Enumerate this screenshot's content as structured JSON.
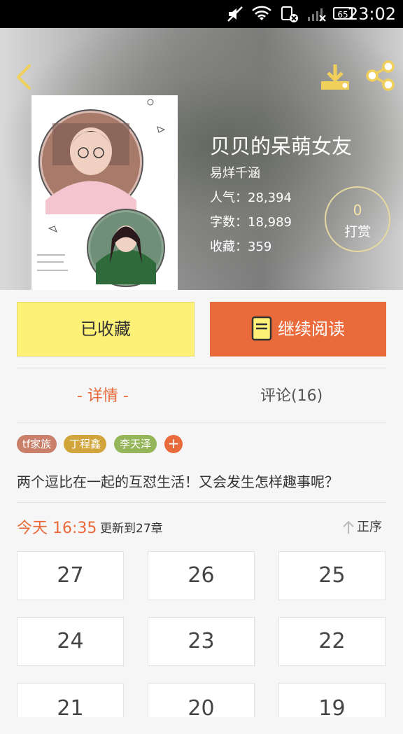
{
  "status_bar": {
    "time": "23:02",
    "battery": "65"
  },
  "book": {
    "title": "贝贝的呆萌女友",
    "author": "易烊千涵",
    "popularity": "人气：28,394",
    "word_count": "字数：18,989",
    "favorites": "收藏：359"
  },
  "reward": {
    "count": "0",
    "label": "打赏"
  },
  "actions": {
    "favorited_label": "已收藏",
    "continue_label": "继续阅读"
  },
  "tabs": {
    "detail": "- 详情 -",
    "comments": "评论(16)"
  },
  "tags": [
    {
      "label": "tf家族",
      "color": "#c97f6a"
    },
    {
      "label": "丁程鑫",
      "color": "#d2a43c"
    },
    {
      "label": "李天泽",
      "color": "#94b558"
    }
  ],
  "tag_add": "+",
  "description": "两个逗比在一起的互怼生活！又会发生怎样趣事呢？",
  "update": {
    "time": "今天 16:35",
    "label": "更新到27章"
  },
  "sort_label": "正序",
  "chapters": [
    "27",
    "26",
    "25",
    "24",
    "23",
    "22",
    "21",
    "20",
    "19"
  ],
  "colors": {
    "accent": "#e96a3b",
    "favorite_yellow": "#fdf178"
  },
  "icons": {
    "back": "chevron-left-icon",
    "download": "download-icon",
    "share": "share-icon",
    "book": "book-icon",
    "sort": "arrow-up-icon"
  }
}
